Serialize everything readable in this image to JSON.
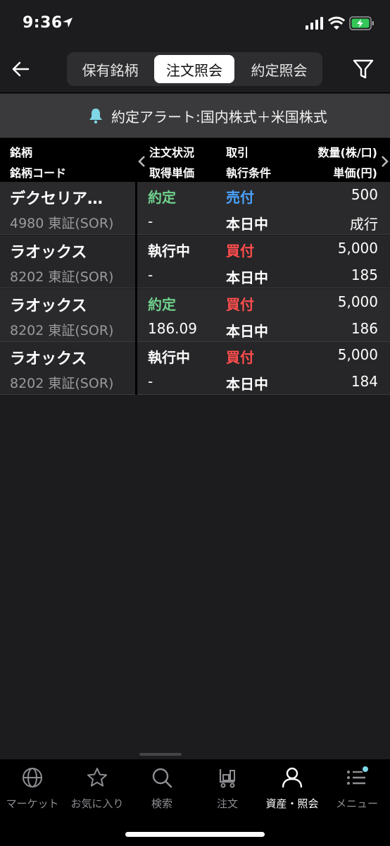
{
  "status_bar": {
    "time": "9:36"
  },
  "header": {
    "tabs": [
      {
        "label": "保有銘柄",
        "active": false
      },
      {
        "label": "注文照会",
        "active": true
      },
      {
        "label": "約定照会",
        "active": false
      }
    ]
  },
  "alert": {
    "text": "約定アラート:国内株式＋米国株式"
  },
  "table": {
    "headers": {
      "col1_top": "銘柄",
      "col1_bottom": "銘柄コード",
      "col2_top": "注文状況",
      "col2_bottom": "取得単価",
      "col3_top": "取引",
      "col3_bottom": "執行条件",
      "col4_top": "数量(株/口)",
      "col4_bottom": "単価(円)"
    },
    "rows": [
      {
        "name": "デクセリア…",
        "code": "4980  東証(SOR)",
        "status": "約定",
        "price": "-",
        "trade": "売付",
        "condition": "本日中",
        "quantity": "500",
        "unit_price": "成行"
      },
      {
        "name": "ラオックス",
        "code": "8202  東証(SOR)",
        "status": "執行中",
        "price": "-",
        "trade": "買付",
        "condition": "本日中",
        "quantity": "5,000",
        "unit_price": "185"
      },
      {
        "name": "ラオックス",
        "code": "8202  東証(SOR)",
        "status": "約定",
        "price": "186.09",
        "trade": "買付",
        "condition": "本日中",
        "quantity": "5,000",
        "unit_price": "186"
      },
      {
        "name": "ラオックス",
        "code": "8202  東証(SOR)",
        "status": "執行中",
        "price": "-",
        "trade": "買付",
        "condition": "本日中",
        "quantity": "5,000",
        "unit_price": "184"
      }
    ]
  },
  "colors": {
    "executed": "#6fd08c",
    "sell": "#4aa3ff",
    "buy": "#ff4d4d",
    "working": "#ffffff",
    "alert_bell": "#7fd7e6"
  },
  "bottom_nav": {
    "items": [
      {
        "label": "マーケット",
        "icon": "globe-icon",
        "active": false
      },
      {
        "label": "お気に入り",
        "icon": "star-icon",
        "active": false
      },
      {
        "label": "検索",
        "icon": "search-icon",
        "active": false
      },
      {
        "label": "注文",
        "icon": "cart-icon",
        "active": false
      },
      {
        "label": "資産・照会",
        "icon": "person-icon",
        "active": true
      },
      {
        "label": "メニュー",
        "icon": "menu-icon",
        "active": false
      }
    ]
  }
}
